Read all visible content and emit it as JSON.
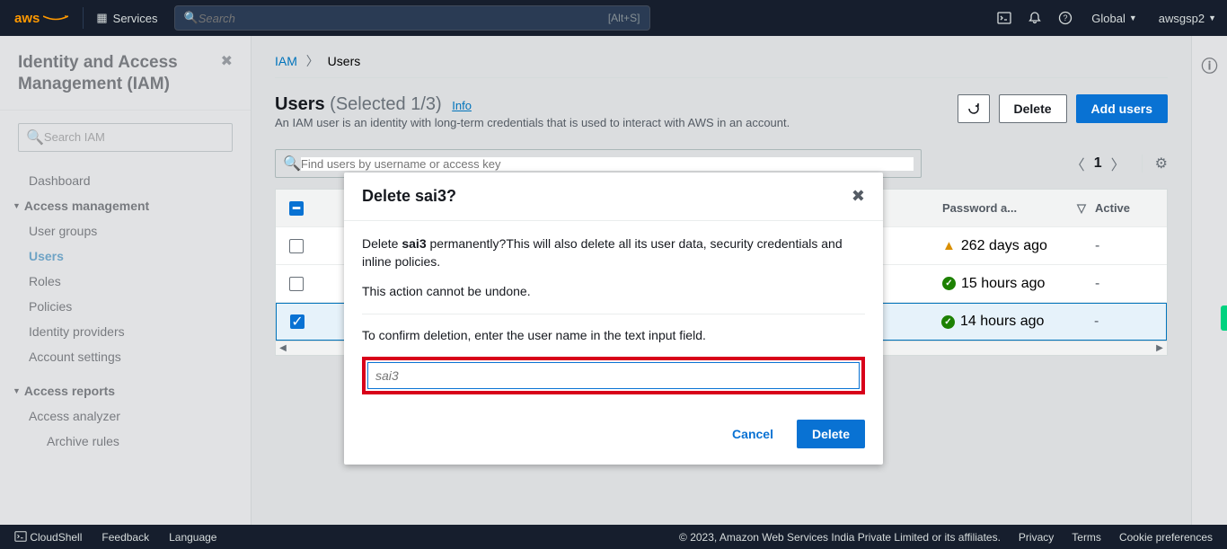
{
  "topnav": {
    "logo": "aws",
    "services": "Services",
    "search_placeholder": "Search",
    "search_kbd": "[Alt+S]",
    "region": "Global",
    "account": "awsgsp2"
  },
  "sidebar": {
    "title": "Identity and Access Management (IAM)",
    "search_placeholder": "Search IAM",
    "items": [
      {
        "label": "Dashboard",
        "type": "item"
      },
      {
        "label": "Access management",
        "type": "section"
      },
      {
        "label": "User groups",
        "type": "item"
      },
      {
        "label": "Users",
        "type": "item",
        "active": true
      },
      {
        "label": "Roles",
        "type": "item"
      },
      {
        "label": "Policies",
        "type": "item"
      },
      {
        "label": "Identity providers",
        "type": "item"
      },
      {
        "label": "Account settings",
        "type": "item"
      },
      {
        "label": "Access reports",
        "type": "section"
      },
      {
        "label": "Access analyzer",
        "type": "item"
      },
      {
        "label": "Archive rules",
        "type": "sub"
      }
    ]
  },
  "breadcrumb": {
    "root": "IAM",
    "leaf": "Users"
  },
  "page": {
    "title": "Users",
    "selected": "(Selected 1/3)",
    "info": "Info",
    "desc": "An IAM user is an identity with long-term credentials that is used to interact with AWS in an account.",
    "btn_refresh": "↻",
    "btn_delete": "Delete",
    "btn_add": "Add users",
    "filter_placeholder": "Find users by username or access key",
    "page_num": "1"
  },
  "table": {
    "headers": {
      "pw": "Password a...",
      "active": "Active"
    },
    "rows": [
      {
        "checked": false,
        "pw": {
          "status": "warn",
          "text": "262 days ago"
        },
        "active": "-"
      },
      {
        "checked": false,
        "pw": {
          "status": "ok",
          "text": "15 hours ago"
        },
        "active": "-"
      },
      {
        "checked": true,
        "pw": {
          "status": "ok",
          "text": "14 hours ago"
        },
        "active": "-"
      }
    ]
  },
  "modal": {
    "title": "Delete sai3?",
    "p1a": "Delete ",
    "p1b": "sai3",
    "p1c": " permanently?This will also delete all its user data, security credentials and inline policies.",
    "p2": "This action cannot be undone.",
    "p3": "To confirm deletion, enter the user name in the text input field.",
    "placeholder": "sai3",
    "cancel": "Cancel",
    "delete": "Delete"
  },
  "footer": {
    "cloudshell": "CloudShell",
    "feedback": "Feedback",
    "language": "Language",
    "copyright": "© 2023, Amazon Web Services India Private Limited or its affiliates.",
    "privacy": "Privacy",
    "terms": "Terms",
    "cookies": "Cookie preferences"
  }
}
